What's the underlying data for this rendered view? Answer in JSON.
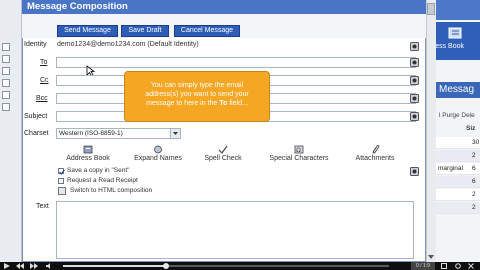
{
  "window": {
    "title": "Message Composition"
  },
  "toolbar": {
    "send": "Send Message",
    "save_draft": "Save Draft",
    "cancel": "Cancel Message"
  },
  "form": {
    "identity_label": "Identity",
    "identity_value": "demo1234@demo1234.com (Default Identity)",
    "to_label": "To",
    "to_value": "",
    "cc_label": "Cc",
    "bcc_label": "Bcc",
    "subject_label": "Subject",
    "charset_label": "Charset",
    "charset_value": "Western (ISO-8859-1)",
    "text_label": "Text"
  },
  "tools": [
    {
      "label": "Address Book",
      "icon": "address-book-icon"
    },
    {
      "label": "Expand Names",
      "icon": "expand-names-icon"
    },
    {
      "label": "Spell Check",
      "icon": "spell-check-icon"
    },
    {
      "label": "Special Characters",
      "icon": "special-characters-icon"
    },
    {
      "label": "Attachments",
      "icon": "paperclip-icon"
    }
  ],
  "options": {
    "save_copy": "Save a copy in \"Sent\"",
    "save_copy_checked": true,
    "read_receipt": "Request a Read Receipt",
    "read_receipt_checked": false,
    "html_switch": "Switch to HTML composition"
  },
  "tooltip": {
    "line1": "You can simply type the email",
    "line2": "address(s) you want to send your",
    "line3_prefix": "message to here in the ",
    "line3_bold": "To",
    "line3_suffix": " field..."
  },
  "background": {
    "address_book": "dress Book",
    "messages": "Messag",
    "purge": "l Purge Dele",
    "size_header": "Siz",
    "rows": [
      {
        "col1": "",
        "col2": "30"
      },
      {
        "col1": "",
        "col2": "2"
      },
      {
        "col1": "marginal",
        "col2": "6"
      },
      {
        "col1": "",
        "col2": "6"
      },
      {
        "col1": "",
        "col2": "2"
      },
      {
        "col1": "",
        "col2": "2"
      }
    ]
  },
  "player": {
    "time": "0 / 1:9"
  },
  "colors": {
    "title_blue": "#4a75c7",
    "button_blue": "#2e5db8",
    "tooltip_orange": "#f5a623"
  }
}
